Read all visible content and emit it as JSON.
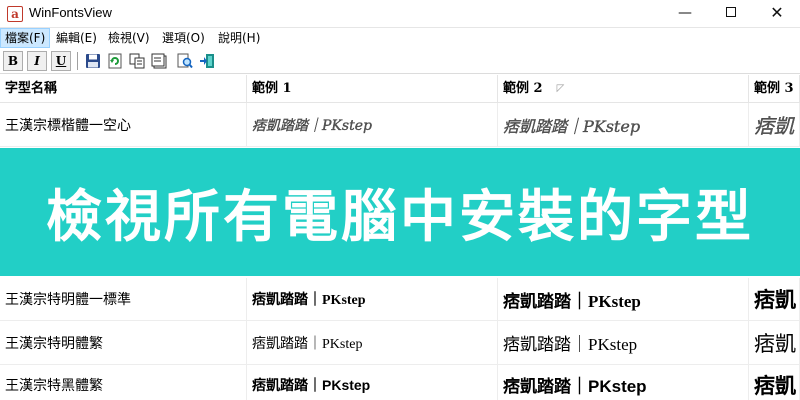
{
  "window": {
    "title": "WinFontsView",
    "app_icon_glyph": "a",
    "minimize_glyph": "—",
    "close_glyph": "✕"
  },
  "menu": [
    {
      "label": "檔案(F)"
    },
    {
      "label": "編輯(E)"
    },
    {
      "label": "檢視(V)"
    },
    {
      "label": "選項(O)"
    },
    {
      "label": "說明(H)"
    }
  ],
  "toolbar": {
    "bold": "B",
    "italic": "I",
    "underline": "U",
    "icons": [
      "save-icon",
      "refresh-icon",
      "copy-icon",
      "properties-icon",
      "find-icon",
      "exit-icon"
    ]
  },
  "columns": [
    {
      "label": "字型名稱"
    },
    {
      "label": "範例 1"
    },
    {
      "label": "範例 2",
      "sort_glyph": "◸"
    },
    {
      "label": "範例 3"
    }
  ],
  "rows": [
    {
      "name": "王漢宗標楷體一空心",
      "s1": "痞凱踏踏｜PKstep",
      "s2": "痞凱踏踏｜PKstep",
      "s3": "痞凱"
    },
    {
      "name": "王漢宗特明體一標準",
      "s1": "痞凱踏踏｜PKstep",
      "s2": "痞凱踏踏｜PKstep",
      "s3": "痞凱"
    },
    {
      "name": "王漢宗特明體繁",
      "s1": "痞凱踏踏｜PKstep",
      "s2": "痞凱踏踏｜PKstep",
      "s3": "痞凱"
    },
    {
      "name": "王漢宗特黑體繁",
      "s1": "痞凱踏踏｜PKstep",
      "s2": "痞凱踏踏｜PKstep",
      "s3": "痞凱"
    }
  ],
  "banner": {
    "text": "檢視所有電腦中安裝的字型",
    "color": "#22cfc6"
  }
}
